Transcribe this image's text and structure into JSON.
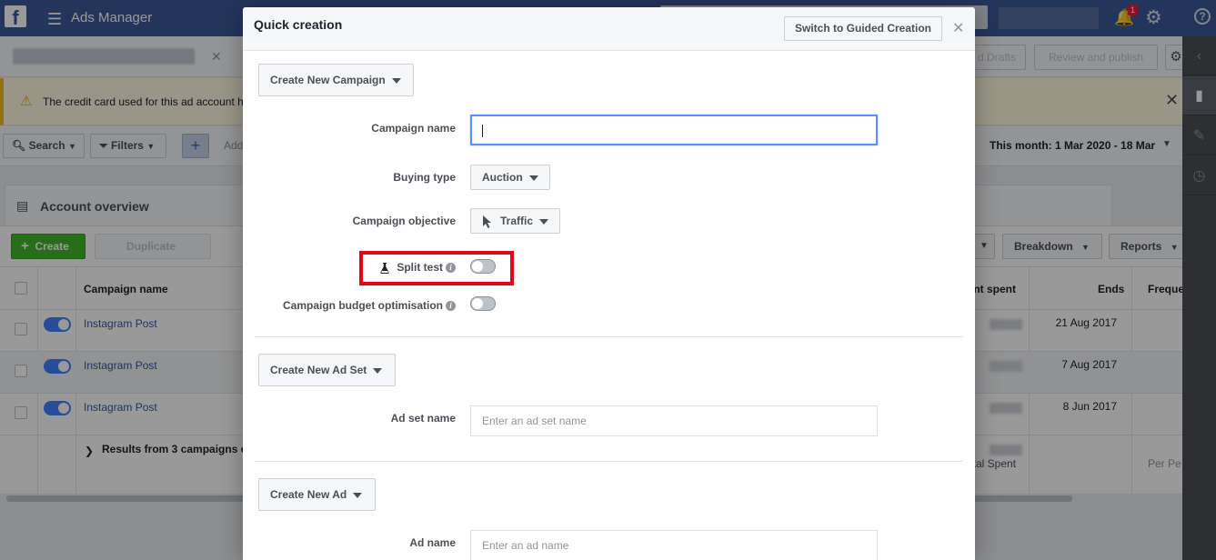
{
  "app": {
    "title": "Ads Manager",
    "notification_count": "1"
  },
  "subbar": {
    "drafts_label": "d Drafts",
    "publish_label": "Review and publish"
  },
  "alert": {
    "text": "The credit card used for this ad account h"
  },
  "filterbar": {
    "search_label": "Search",
    "filters_label": "Filters",
    "add_label": "Add",
    "date_range": "This month: 1 Mar 2020 - 18 Mar"
  },
  "overview": {
    "title": "Account overview"
  },
  "actions": {
    "create_label": "Create",
    "duplicate_label": "Duplicate",
    "breakdown_label": "Breakdown",
    "reports_label": "Reports"
  },
  "table": {
    "headers": {
      "campaign_name": "Campaign name",
      "amount_spent": "unt spent",
      "ends": "Ends",
      "frequency": "Freque"
    },
    "rows": [
      {
        "name": "Instagram Post",
        "ends": "21 Aug 2017"
      },
      {
        "name": "Instagram Post",
        "ends": "7 Aug 2017"
      },
      {
        "name": "Instagram Post",
        "ends": "8 Jun 2017"
      }
    ],
    "results_text": "Results from 3 campaigns e",
    "total_spent_label": "otal Spent",
    "per_label": "Per Pe"
  },
  "modal": {
    "title": "Quick creation",
    "switch_label": "Switch to Guided Creation",
    "campaign_section": {
      "dropdown_label": "Create New Campaign",
      "campaign_name_label": "Campaign name",
      "campaign_name_value": "",
      "buying_type_label": "Buying type",
      "buying_type_value": "Auction",
      "objective_label": "Campaign objective",
      "objective_value": "Traffic",
      "split_test_label": "Split test",
      "split_test_on": false,
      "budget_opt_label": "Campaign budget optimisation",
      "budget_opt_on": false
    },
    "adset_section": {
      "dropdown_label": "Create New Ad Set",
      "name_label": "Ad set name",
      "name_placeholder": "Enter an ad set name"
    },
    "ad_section": {
      "dropdown_label": "Create New Ad",
      "name_label": "Ad name",
      "name_placeholder": "Enter an ad name"
    }
  },
  "colors": {
    "brand": "#3b5998",
    "create_green": "#42b72a",
    "highlight_red": "#e30613",
    "focus_blue": "#5890ff"
  }
}
